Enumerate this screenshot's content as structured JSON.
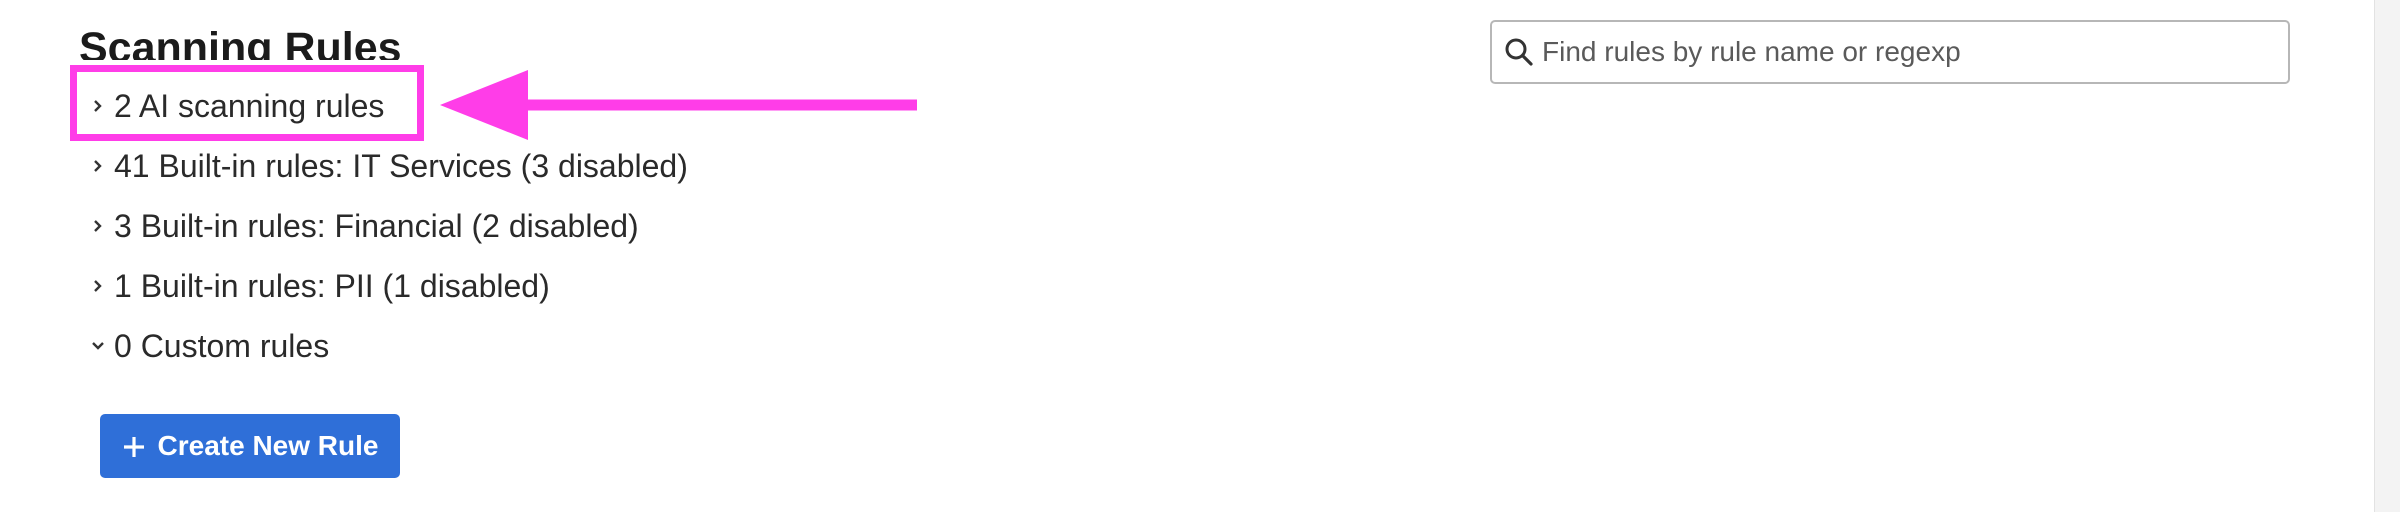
{
  "page": {
    "title": "Scanning Rules"
  },
  "search": {
    "placeholder": "Find rules by rule name or regexp",
    "value": ""
  },
  "rule_groups": [
    {
      "label": "2 AI scanning rules",
      "expanded": false
    },
    {
      "label": "41 Built-in rules: IT Services (3 disabled)",
      "expanded": false
    },
    {
      "label": "3 Built-in rules: Financial (2 disabled)",
      "expanded": false
    },
    {
      "label": "1 Built-in rules: PII (1 disabled)",
      "expanded": false
    },
    {
      "label": "0 Custom rules",
      "expanded": true
    }
  ],
  "actions": {
    "create_label": "Create New Rule"
  },
  "icons": {
    "collapsed": "chevron-right-icon",
    "expanded": "chevron-down-icon",
    "search": "search-icon",
    "create": "plus-icon"
  },
  "colors": {
    "annotation": "#ff3de8",
    "primary_button": "#2f6fd8",
    "text": "#2a2a2a"
  }
}
